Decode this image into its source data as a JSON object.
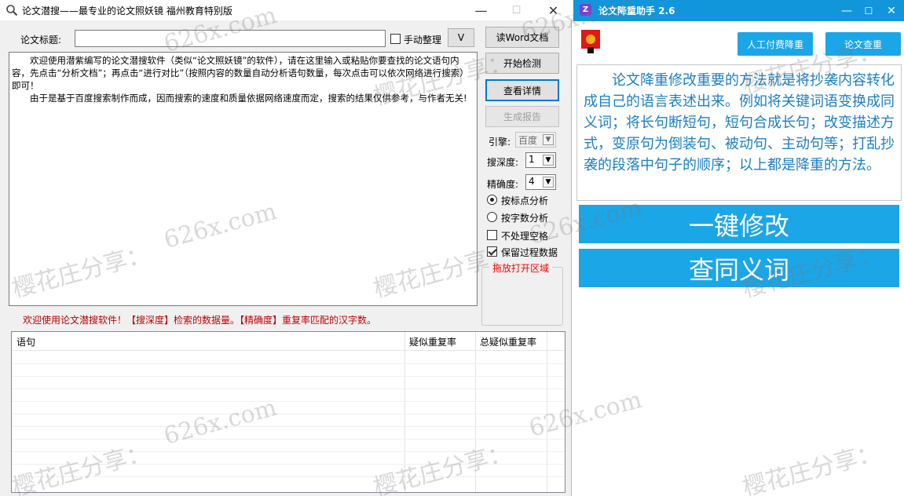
{
  "left_window": {
    "title": "论文潜搜——最专业的论文照妖镜 福州教育特别版",
    "controls": {
      "minimize": "—",
      "maximize": "☐",
      "close": "✕"
    },
    "paper_title_label": "论文标题:",
    "paper_title_value": "",
    "manual_tidy": {
      "label": "手动整理",
      "checked": false
    },
    "v_button": "V",
    "main_text": [
      "欢迎使用潜紫编写的论文潜搜软件（类似“论文照妖镜”的软件），请在这里输入或粘贴你要查找的论文语句内容，先点击“分析文档”；再点击“进行对比”（按照内容的数量自动分析语句数量，每次点击可以依次网络进行搜索）即可！",
      "由于是基于百度搜索制作而成，因而搜索的速度和质量依据网络速度而定，搜索的结果仅供参考，与作者无关!"
    ],
    "buttons": {
      "read_word": "读Word文档",
      "start_check": "开始检测",
      "view_details": "查看详情",
      "generate_report": "生成报告"
    },
    "engine": {
      "label": "引擎:",
      "value": "百度"
    },
    "depth": {
      "label": "搜深度:",
      "value": "1"
    },
    "precision": {
      "label": "精确度:",
      "value": "4"
    },
    "analysis_modes": [
      {
        "label": "按标点分析",
        "checked": true
      },
      {
        "label": "按字数分析",
        "checked": false
      }
    ],
    "options": [
      {
        "label": "不处理空格",
        "checked": false
      },
      {
        "label": "保留过程数据",
        "checked": true
      }
    ],
    "dropzone_label": "拖放打开区域",
    "status": "欢迎使用论文潜搜软件！【搜深度】检索的数据量。【精确度】重复率匹配的汉字数。",
    "table": {
      "columns": [
        "语句",
        "疑似重复率",
        "总疑似重复率"
      ]
    }
  },
  "right_window": {
    "title": "论文降重助手 2.6",
    "controls": {
      "minimize": "—",
      "maximize": "☐",
      "close": "✕"
    },
    "manual_reduce_button": "人工付费降重",
    "paper_check_button": "论文查重",
    "tip": "论文降重修改重要的方法就是将抄袭内容转化成自己的语言表述出来。例如将关键词语变换成同义词；将长句断短句，短句合成长句；改变描述方式，变原句为倒装句、被动句、主动句等；打乱抄袭的段落中句子的顺序；以上都是降重的方法。",
    "one_click_button": "一键修改",
    "synonym_button": "查同义词"
  },
  "watermark": {
    "site": "626x.com",
    "text": "樱花庄分享："
  },
  "colors": {
    "accent_blue": "#1ba6e8",
    "titlebar_blue": "#1196db",
    "tip_text": "#1b7fc4",
    "status_red": "#c00000"
  }
}
